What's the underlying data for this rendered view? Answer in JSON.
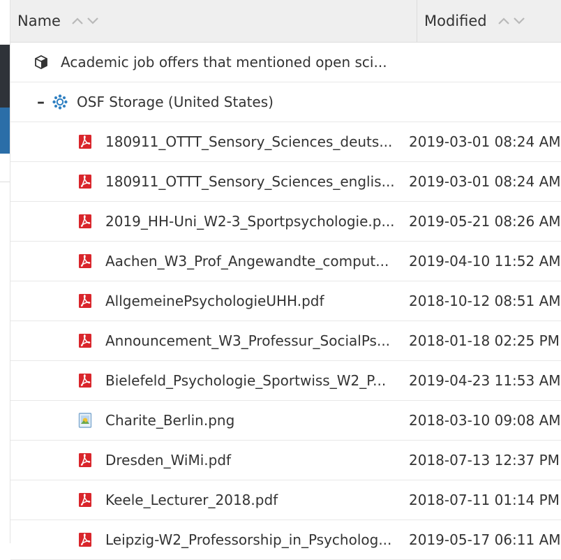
{
  "header": {
    "name_label": "Name",
    "modified_label": "Modified"
  },
  "project": {
    "label": "Academic job offers that mentioned open sci...",
    "icon": "cube-icon"
  },
  "storage": {
    "toggle": "–",
    "label": "OSF Storage (United States)",
    "icon": "storage-gear-icon"
  },
  "colors": {
    "pdf_red": "#d9252b",
    "header_bg": "#efefef",
    "storage_blue": "#2e7fc1"
  },
  "files": [
    {
      "name": "180911_OTTT_Sensory_Sciences_deuts...",
      "modified": "2019-03-01 08:24 AM",
      "type": "pdf"
    },
    {
      "name": "180911_OTTT_Sensory_Sciences_englis...",
      "modified": "2019-03-01 08:24 AM",
      "type": "pdf"
    },
    {
      "name": "2019_HH-Uni_W2-3_Sportpsychologie.p...",
      "modified": "2019-05-21 08:26 AM",
      "type": "pdf"
    },
    {
      "name": "Aachen_W3_Prof_Angewandte_comput...",
      "modified": "2019-04-10 11:52 AM",
      "type": "pdf"
    },
    {
      "name": "AllgemeinePsychologieUHH.pdf",
      "modified": "2018-10-12 08:51 AM",
      "type": "pdf"
    },
    {
      "name": "Announcement_W3_Professur_SocialPs...",
      "modified": "2018-01-18 02:25 PM",
      "type": "pdf"
    },
    {
      "name": "Bielefeld_Psychologie_Sportwiss_W2_P...",
      "modified": "2019-04-23 11:53 AM",
      "type": "pdf"
    },
    {
      "name": "Charite_Berlin.png",
      "modified": "2018-03-10 09:08 AM",
      "type": "image"
    },
    {
      "name": "Dresden_WiMi.pdf",
      "modified": "2018-07-13 12:37 PM",
      "type": "pdf"
    },
    {
      "name": "Keele_Lecturer_2018.pdf",
      "modified": "2018-07-11 01:14 PM",
      "type": "pdf"
    },
    {
      "name": "Leipzig-W2_Professorship_in_Psycholog...",
      "modified": "2019-05-17 06:11 AM",
      "type": "pdf"
    }
  ]
}
